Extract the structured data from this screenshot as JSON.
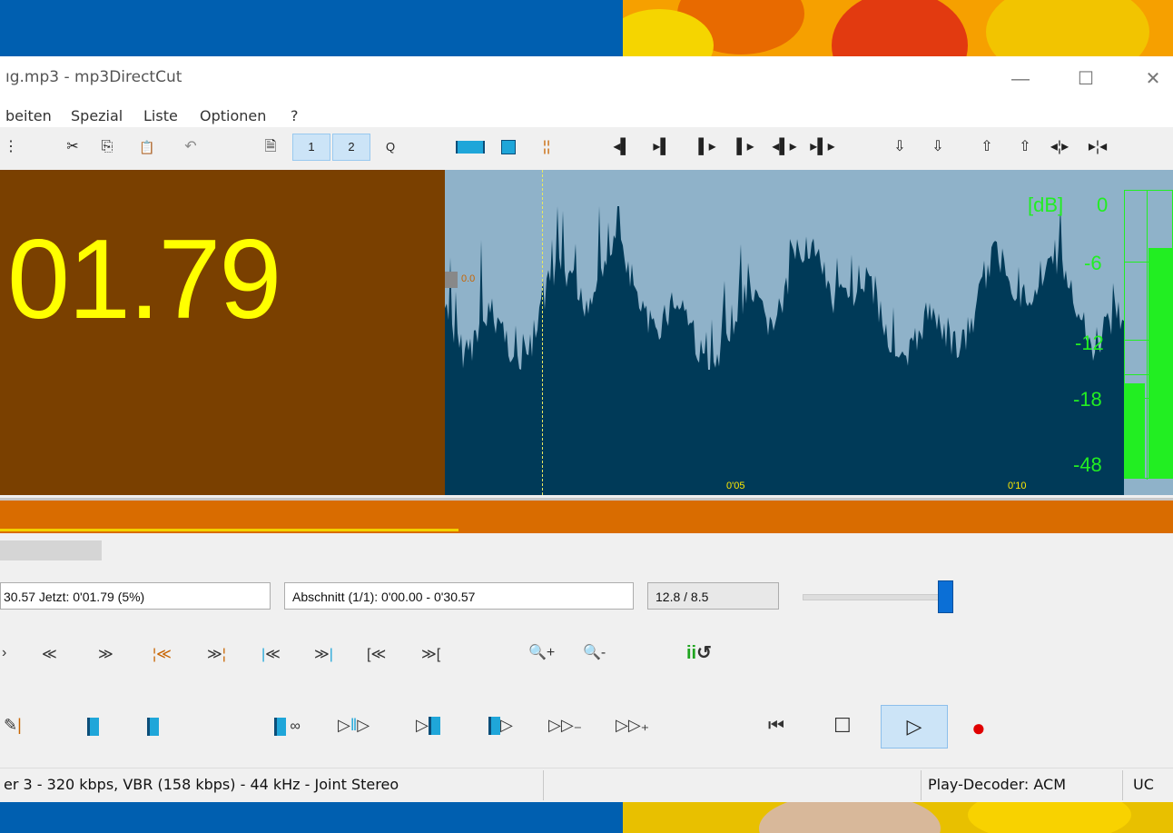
{
  "colors": {
    "desktop": "#005fb0",
    "time_bg": "#7a4000",
    "time_fg": "#ffff00",
    "wave_bg": "#8fb2c9",
    "wave_fg": "#003a58",
    "meter_green": "#22ee22",
    "stripe": "#d96c00"
  },
  "window": {
    "title": "ıg.mp3 - mp3DirectCut",
    "minimize_icon": "minimize-icon",
    "maximize_icon": "maximize-icon",
    "close_icon": "close-icon"
  },
  "menubar": {
    "items": [
      "beiten",
      "Spezial",
      "Liste",
      "Optionen",
      "?"
    ]
  },
  "toolbar": {
    "icons": [
      "cut-icon",
      "copy-icon",
      "paste-icon",
      "undo-icon",
      "page-icon",
      "page-1-icon",
      "page-2-icon",
      "page-q-icon"
    ],
    "glyphs": {
      "cut": "✂",
      "copy": "⎘",
      "paste": "📋",
      "undo": "↶",
      "page": "🗎",
      "p1": "1",
      "p2": "2",
      "pq": "Q"
    }
  },
  "display": {
    "time": "01.79",
    "cue_marker": "0.0",
    "tick_1": "0'05",
    "tick_2": "0'10",
    "db_label": "[dB]",
    "db_scale": [
      "0",
      "-6",
      "-12",
      "-18",
      "-48"
    ]
  },
  "meter": {
    "left_level_fraction": 0.33,
    "right_level_fraction": 0.8
  },
  "info": {
    "position": "30.57  Jetzt: 0'01.79  (5%)",
    "section": "Abschnitt (1/1): 0'00.00 - 0'30.57",
    "rate": "12.8 / 8.5"
  },
  "volume": {
    "level_fraction": 0.95
  },
  "nav_buttons": {
    "back_fast": "«",
    "forward_fast": "»",
    "zoom_in": "🔍+",
    "zoom_out": "🔍-"
  },
  "transport": {
    "glyph_prev": "⏮",
    "glyph_stop": "☐",
    "glyph_play": "▷",
    "glyph_record": "●"
  },
  "status": {
    "format": "er 3 - 320 kbps, VBR (158 kbps) - 44 kHz - Joint Stereo",
    "decoder": "Play-Decoder: ACM",
    "mode": "UC"
  }
}
